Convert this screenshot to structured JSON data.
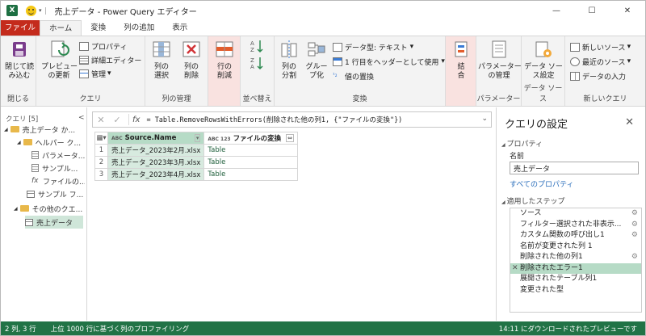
{
  "title_bar": {
    "app_icon": "X",
    "title": "売上データ - Power Query エディター",
    "minimize": "—",
    "restore": "☐",
    "close": "✕"
  },
  "ribbon_tabs": [
    "ファイル",
    "ホーム",
    "変換",
    "列の追加",
    "表示"
  ],
  "ribbon": {
    "close": {
      "big": "閉じて読\nみ込む",
      "group": "閉じる"
    },
    "query": {
      "preview": "プレビュー\nの更新",
      "properties": "プロパティ",
      "advanced": "詳細エディター",
      "manage": "管理",
      "group": "クエリ"
    },
    "columns": {
      "select": "列の\n選択",
      "remove": "列の\n削除",
      "group": "列の管理"
    },
    "rows": {
      "reduce": "行の\n削減",
      "group": ""
    },
    "sort": {
      "group": "並べ替え"
    },
    "transform": {
      "split": "列の\n分割",
      "group_by": "グルー\nプ化",
      "data_type": "データ型: テキスト",
      "first_row_header": "1 行目をヘッダーとして使用",
      "replace": "値の置換",
      "group": "変換"
    },
    "combine": {
      "label": "結\n合",
      "group": ""
    },
    "params": {
      "label": "パラメーター\nの管理",
      "group": "パラメーター"
    },
    "datasource": {
      "label": "データ ソー\nス設定",
      "group": "データ ソース"
    },
    "newquery": {
      "new_source": "新しいソース",
      "recent": "最近のソース",
      "enter": "データの入力",
      "group": "新しいクエリ"
    }
  },
  "queries_pane": {
    "header": "クエリ [5]",
    "collapse": "<",
    "items": [
      {
        "label": "売上データ か...",
        "icon": "folder"
      },
      {
        "label": "ヘルパー ク...",
        "icon": "folder"
      },
      {
        "label": "パラメータ...",
        "icon": "param"
      },
      {
        "label": "サンプル...",
        "icon": "param"
      },
      {
        "label": "ファイルの...",
        "icon": "fx"
      },
      {
        "label": "サンプル フ...",
        "icon": "table"
      },
      {
        "label": "その他のクエ...",
        "icon": "folder"
      },
      {
        "label": "売上データ",
        "icon": "table",
        "selected": true
      }
    ]
  },
  "formula_bar": {
    "cancel": "✕",
    "commit": "✓",
    "fx": "fx",
    "formula": "= Table.RemoveRowsWithErrors(削除された他の列1, {\"ファイルの変換\"})"
  },
  "grid": {
    "col1_type": "ABC",
    "col1": "Source.Name",
    "col2_type": "ABC 123",
    "col2": "ファイルの変換",
    "rows": [
      {
        "n": "1",
        "name": "売上データ_2023年2月.xlsx",
        "value": "Table"
      },
      {
        "n": "2",
        "name": "売上データ_2023年3月.xlsx",
        "value": "Table"
      },
      {
        "n": "3",
        "name": "売上データ_2023年4月.xlsx",
        "value": "Table"
      }
    ]
  },
  "settings": {
    "title": "クエリの設定",
    "close": "✕",
    "properties_header": "プロパティ",
    "name_label": "名前",
    "name_value": "売上データ",
    "all_properties": "すべてのプロパティ",
    "steps_header": "適用したステップ",
    "steps": [
      {
        "label": "ソース",
        "gear": true
      },
      {
        "label": "フィルター選択された非表示...",
        "gear": true
      },
      {
        "label": "カスタム関数の呼び出し1",
        "gear": true
      },
      {
        "label": "名前が変更された列 1",
        "gear": false
      },
      {
        "label": "削除された他の列1",
        "gear": true
      },
      {
        "label": "削除されたエラー1",
        "gear": false,
        "selected": true
      },
      {
        "label": "展開されたテーブル列1",
        "gear": false
      },
      {
        "label": "変更された型",
        "gear": false
      }
    ]
  },
  "status": {
    "dims": "2 列, 3 行",
    "profiling": "上位 1000 行に基づく列のプロファイリング",
    "download": "14:11 にダウンロードされたプレビューです"
  }
}
